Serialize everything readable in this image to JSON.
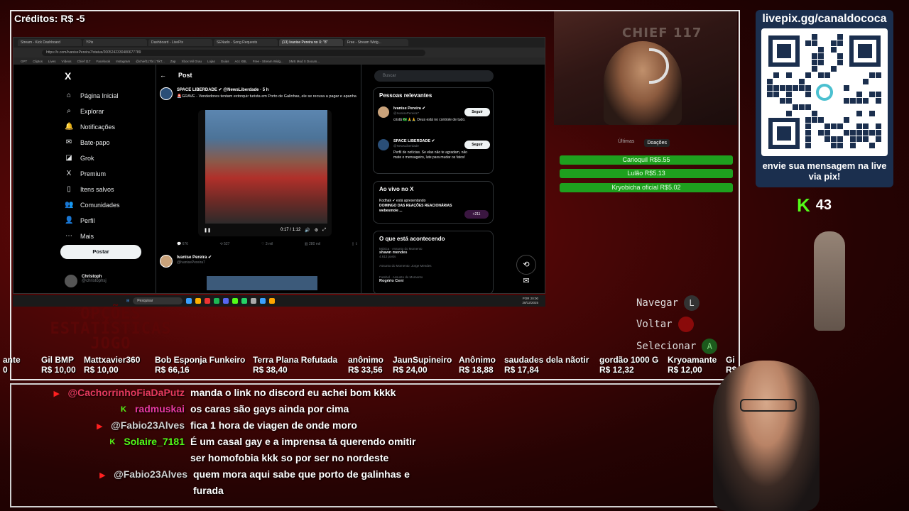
{
  "credits": "Créditos: R$ -5",
  "browser": {
    "tabs": [
      "Stream - Kick Dashboard",
      "YPix",
      "Dashboard - LivePix",
      "SENado - Song Requests",
      "(13) Ivanise Pereira no X: \"8\"",
      "Free - Stream Widg..."
    ],
    "url": "https://x.com/IvanisePereira7/status/2005242330480677789",
    "bookmarks": [
      "GPT",
      "Cliptos",
      "Lives",
      "Vídeos",
      "Chief 117",
      "Facebook",
      "Instagram",
      "@chief117bt | TikT...",
      "Zap",
      "Xbox Mil Grau",
      "Lojas",
      "Guias",
      "Acc XBL",
      "Free - Stream Widg...",
      "XMS Mod X Docum..."
    ]
  },
  "x": {
    "logo": "X",
    "nav": [
      {
        "icon": "⌂",
        "icon_name": "home-icon",
        "label": "Página Inicial"
      },
      {
        "icon": "⌕",
        "icon_name": "search-icon",
        "label": "Explorar"
      },
      {
        "icon": "🔔",
        "icon_name": "bell-icon",
        "label": "Notificações"
      },
      {
        "icon": "✉",
        "icon_name": "mail-icon",
        "label": "Bate-papo"
      },
      {
        "icon": "◪",
        "icon_name": "grok-icon",
        "label": "Grok"
      },
      {
        "icon": "X",
        "icon_name": "premium-icon",
        "label": "Premium"
      },
      {
        "icon": "▯",
        "icon_name": "bookmark-icon",
        "label": "Itens salvos"
      },
      {
        "icon": "👥",
        "icon_name": "people-icon",
        "label": "Comunidades"
      },
      {
        "icon": "👤",
        "icon_name": "profile-icon",
        "label": "Perfil"
      },
      {
        "icon": "⋯",
        "icon_name": "more-icon",
        "label": "Mais"
      }
    ],
    "post_button": "Postar",
    "me_name": "Christoph",
    "me_handle": "@christophsj",
    "post_header": "Post",
    "tweet_name": "SPACE LIBERDADE ✔ @NewsLiberdade · 5 h",
    "tweet_text": "🚨GRAVE - Vendedores tentam extorquir turista em Porto de Galinhas, ele se recusa a pagar e apanha",
    "video_time": "0:17 / 1:12",
    "actions": [
      "676",
      "527",
      "3 mil",
      "280 mil"
    ],
    "reply_name": "Ivanise Pereira ✔",
    "reply_handle": "@IvanisePereira7",
    "search_placeholder": "Buscar",
    "relevant_title": "Pessoas relevantes",
    "relevant": [
      {
        "name": "Ivanise Pereira ✔",
        "handle": "@IvanisePereira7",
        "bio": "cristã 🇧🇷🙏🙏 Deus está no controle de tudo.",
        "follow": "Seguir"
      },
      {
        "name": "SPACE LIBERDADE ✔",
        "handle": "@NewsLiberdade",
        "bio": "Perfil de notícias. Se elas não te agradam, não mate o mensageiro, lute para mudar os fatos!",
        "follow": "Seguir"
      }
    ],
    "live_title": "Ao vivo no X",
    "live_host": "Kodhak ✔ está apresentando",
    "live_text": "DOMINGO DAS REAÇÕES REACIONÁRIAS webesmole ...",
    "live_count": "+211",
    "trends_title": "O que está acontecendo",
    "trends": [
      {
        "cat": "Música · Assunto do Momento",
        "name": "shawn mendes",
        "count": "4.612 posts"
      },
      {
        "cat": "Assunto do Momento: Jorge Mendes",
        "name": "",
        "count": ""
      },
      {
        "cat": "Futebol · Assunto do Momento",
        "name": "Rogério Ceni",
        "count": ""
      }
    ]
  },
  "taskbar": {
    "search": "Pesquisar",
    "lang": "POR",
    "time": "20:00",
    "date": "28/12/2025"
  },
  "cam_sign": "CHIEF 117",
  "donations": {
    "tabs": [
      "Últimas",
      "Doações"
    ],
    "items": [
      "Carioquil R$5.55",
      "Lulão R$5.13",
      "Kryobicha oficial R$5.02"
    ]
  },
  "hints": [
    {
      "label": "Navegar",
      "key": "L"
    },
    {
      "label": "Voltar",
      "key": "B"
    },
    {
      "label": "Selecionar",
      "key": "A"
    }
  ],
  "opcoes": [
    "OPÇÕES",
    "ESTATÍSTICAS",
    "JOGO"
  ],
  "ticker": [
    {
      "name": "ante",
      "value": "0"
    },
    {
      "name": "Gil BMP",
      "value": "R$ 10,00"
    },
    {
      "name": "Mattxavier360",
      "value": "R$ 10,00"
    },
    {
      "name": "Bob Esponja Funkeiro",
      "value": "R$ 66,16"
    },
    {
      "name": "Terra Plana Refutada",
      "value": "R$ 38,40"
    },
    {
      "name": "anônimo",
      "value": "R$ 33,56"
    },
    {
      "name": "JaunSupineiro",
      "value": "R$ 24,00"
    },
    {
      "name": "Anônimo",
      "value": "R$ 18,88"
    },
    {
      "name": "saudades dela nãotir",
      "value": "R$ 17,84"
    },
    {
      "name": "gordão 1000 G",
      "value": "R$ 12,32"
    },
    {
      "name": "Kryoamante",
      "value": "R$ 12,00"
    },
    {
      "name": "Gi",
      "value": "R$"
    }
  ],
  "chat": [
    {
      "platform": "youtube",
      "user": "@CachorrinhoFiaDaPutz",
      "color": "#e63a5e",
      "msg": "manda o link no discord eu achei bom kkkk",
      "msg2": ""
    },
    {
      "platform": "kick",
      "user": "radmuskai",
      "color": "#e83aa2",
      "msg": "os caras são gays ainda por cima",
      "msg2": ""
    },
    {
      "platform": "youtube",
      "user": "@Fabio23Alves",
      "color": "#d0d0d0",
      "msg": "fica 1 hora de viagen de onde moro",
      "msg2": ""
    },
    {
      "platform": "kick",
      "user": "Solaire_7181",
      "color": "#53fc18",
      "msg": "É um casal gay e a imprensa tá querendo omitir",
      "msg2": "ser homofobia kkk so por ser no nordeste"
    },
    {
      "platform": "youtube",
      "user": "@Fabio23Alves",
      "color": "#d0d0d0",
      "msg": "quem mora aqui sabe que porto de galinhas e",
      "msg2": "furada"
    }
  ],
  "qr": {
    "url": "livepix.gg/canaldococa",
    "text": "envie sua mensagem na live via pix!"
  },
  "kick_count": "43",
  "colors": {
    "kick_green": "#53fc18",
    "donation_green": "#1ea01e",
    "youtube_red": "#ff2020",
    "qr_panel": "#1b2f4e"
  }
}
